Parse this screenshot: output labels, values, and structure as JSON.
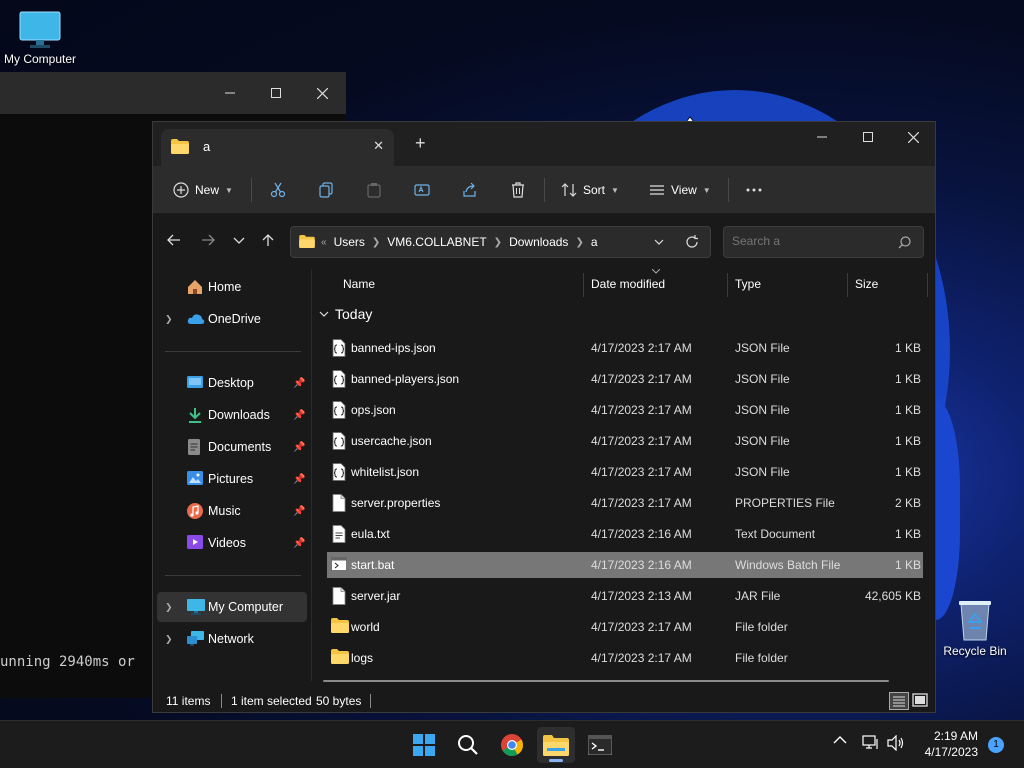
{
  "desktop": {
    "icons": [
      {
        "label": "My Computer",
        "icon": "monitor-icon"
      },
      {
        "label": "Recycle Bin",
        "icon": "recycle-bin-icon"
      }
    ]
  },
  "terminal": {
    "visible_text": "unning 2940ms or"
  },
  "explorer": {
    "tab_title": "a",
    "toolbar": {
      "new_label": "New",
      "sort_label": "Sort",
      "view_label": "View"
    },
    "breadcrumbs": [
      "Users",
      "VM6.COLLABNET",
      "Downloads",
      "a"
    ],
    "search_placeholder": "Search a",
    "sidebar": {
      "home": "Home",
      "onedrive": "OneDrive",
      "quick": [
        {
          "label": "Desktop",
          "icon": "desktop-folder-icon",
          "color": "#3aa0e8"
        },
        {
          "label": "Downloads",
          "icon": "download-icon",
          "color": "#3dc28a"
        },
        {
          "label": "Documents",
          "icon": "documents-icon",
          "color": "#8a8a8a"
        },
        {
          "label": "Pictures",
          "icon": "pictures-icon",
          "color": "#3a8ee8"
        },
        {
          "label": "Music",
          "icon": "music-icon",
          "color": "#e86a4a"
        },
        {
          "label": "Videos",
          "icon": "videos-icon",
          "color": "#8a4ae8"
        }
      ],
      "this_pc": "My Computer",
      "network": "Network"
    },
    "columns": {
      "name": "Name",
      "date": "Date modified",
      "type": "Type",
      "size": "Size"
    },
    "group_label": "Today",
    "files": [
      {
        "name": "banned-ips.json",
        "date": "4/17/2023 2:17 AM",
        "type": "JSON File",
        "size": "1 KB",
        "icon": "json-file-icon"
      },
      {
        "name": "banned-players.json",
        "date": "4/17/2023 2:17 AM",
        "type": "JSON File",
        "size": "1 KB",
        "icon": "json-file-icon"
      },
      {
        "name": "ops.json",
        "date": "4/17/2023 2:17 AM",
        "type": "JSON File",
        "size": "1 KB",
        "icon": "json-file-icon"
      },
      {
        "name": "usercache.json",
        "date": "4/17/2023 2:17 AM",
        "type": "JSON File",
        "size": "1 KB",
        "icon": "json-file-icon"
      },
      {
        "name": "whitelist.json",
        "date": "4/17/2023 2:17 AM",
        "type": "JSON File",
        "size": "1 KB",
        "icon": "json-file-icon"
      },
      {
        "name": "server.properties",
        "date": "4/17/2023 2:17 AM",
        "type": "PROPERTIES File",
        "size": "2 KB",
        "icon": "file-icon"
      },
      {
        "name": "eula.txt",
        "date": "4/17/2023 2:16 AM",
        "type": "Text Document",
        "size": "1 KB",
        "icon": "text-file-icon"
      },
      {
        "name": "start.bat",
        "date": "4/17/2023 2:16 AM",
        "type": "Windows Batch File",
        "size": "1 KB",
        "icon": "batch-file-icon",
        "selected": true
      },
      {
        "name": "server.jar",
        "date": "4/17/2023 2:13 AM",
        "type": "JAR File",
        "size": "42,605 KB",
        "icon": "file-icon"
      },
      {
        "name": "world",
        "date": "4/17/2023 2:17 AM",
        "type": "File folder",
        "size": "",
        "icon": "folder-icon"
      },
      {
        "name": "logs",
        "date": "4/17/2023 2:17 AM",
        "type": "File folder",
        "size": "",
        "icon": "folder-icon"
      }
    ],
    "status": {
      "item_count": "11 items",
      "selection": "1 item selected",
      "selection_size": "50 bytes"
    }
  },
  "taskbar": {
    "apps": [
      "start-icon",
      "search-icon",
      "chrome-icon",
      "file-explorer-icon",
      "terminal-icon"
    ],
    "active_app": "file-explorer-icon",
    "clock_time": "2:19 AM",
    "clock_date": "4/17/2023",
    "notification_count": "1"
  },
  "colors": {
    "folder": "#f4c542",
    "accent": "#4aa3ff",
    "selected_row": "#777777"
  }
}
